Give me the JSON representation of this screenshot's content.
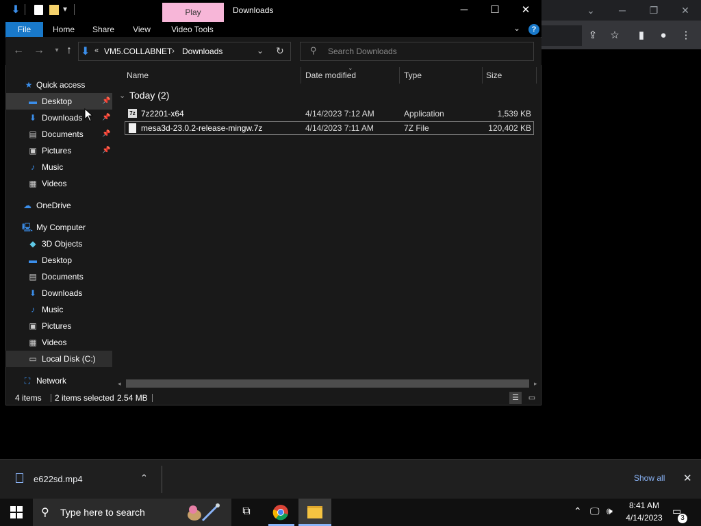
{
  "explorer": {
    "title": "Downloads",
    "play_tab": "Play",
    "ribbon_tabs": [
      "File",
      "Home",
      "Share",
      "View",
      "Video Tools"
    ],
    "window_controls": {
      "minimize": "─",
      "maximize": "☐",
      "close": "✕"
    },
    "help_icon": "?",
    "address": {
      "overflow": "«",
      "segments": [
        "VM5.COLLABNET",
        "Downloads"
      ],
      "separator": "›"
    },
    "search_placeholder": "Search Downloads",
    "nav": {
      "quick_access": "Quick access",
      "items": [
        "Desktop",
        "Downloads",
        "Documents",
        "Pictures",
        "Music",
        "Videos"
      ],
      "onedrive": "OneDrive",
      "my_computer": "My Computer",
      "pc_items": [
        "3D Objects",
        "Desktop",
        "Documents",
        "Downloads",
        "Music",
        "Pictures",
        "Videos",
        "Local Disk (C:)"
      ],
      "network": "Network"
    },
    "columns": {
      "name": "Name",
      "date": "Date modified",
      "type": "Type",
      "size": "Size"
    },
    "group": "Today (2)",
    "files": [
      {
        "name": "7z2201-x64",
        "date": "4/14/2023 7:12 AM",
        "type": "Application",
        "size": "1,539 KB",
        "icon": "7z-icon"
      },
      {
        "name": "mesa3d-23.0.2-release-mingw.7z",
        "date": "4/14/2023 7:11 AM",
        "type": "7Z File",
        "size": "120,402 KB",
        "icon": "file-icon"
      }
    ],
    "status": {
      "items": "4 items",
      "selected": "2 items selected",
      "size": "2.54 MB"
    }
  },
  "download_bar": {
    "file": "e622sd.mp4",
    "show_all": "Show all"
  },
  "taskbar": {
    "search_placeholder": "Type here to search",
    "time": "8:41 AM",
    "date": "4/14/2023",
    "notifications": "3"
  },
  "colors": {
    "accent": "#1979ca",
    "play_tab": "#f7b6d8",
    "link": "#8ab4f8"
  }
}
